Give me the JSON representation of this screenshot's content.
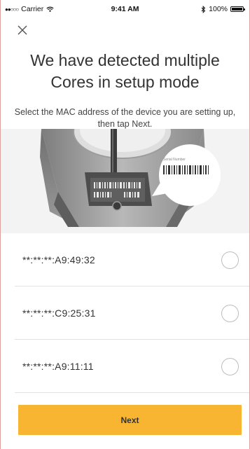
{
  "status_bar": {
    "signal": "●●○○○",
    "carrier": "Carrier",
    "time": "9:41 AM",
    "battery_percent": "100%"
  },
  "header": {
    "title_line1": "We have detected multiple",
    "title_line2": "Cores in setup mode",
    "instruction": "Select the MAC address of the device you are setting up, then tap Next."
  },
  "illustration": {
    "callout_label": "Serial Number"
  },
  "devices": [
    {
      "mac": "**:**:**:A9:49:32",
      "selected": false
    },
    {
      "mac": "**:**:**:C9:25:31",
      "selected": false
    },
    {
      "mac": "**:**:**:A9:11:11",
      "selected": false
    }
  ],
  "actions": {
    "next_label": "Next"
  },
  "colors": {
    "accent": "#f7b532",
    "illustration_bg": "#f3f3f3",
    "divider": "#e2e2e2"
  },
  "icons": {
    "close": "close-icon",
    "wifi": "wifi-icon",
    "bluetooth": "bluetooth-icon",
    "battery": "battery-icon"
  }
}
